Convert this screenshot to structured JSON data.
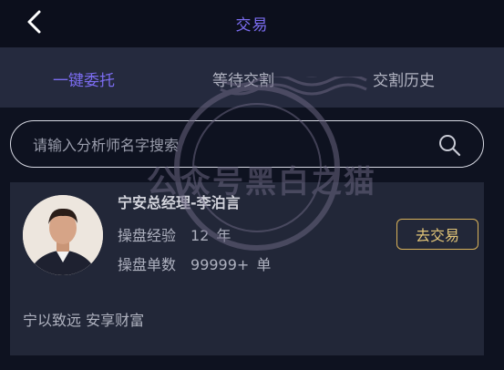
{
  "header": {
    "title": "交易"
  },
  "tabs": [
    {
      "label": "一键委托",
      "active": true
    },
    {
      "label": "等待交割",
      "active": false
    },
    {
      "label": "交割历史",
      "active": false
    }
  ],
  "search": {
    "placeholder": "请输入分析师名字搜索"
  },
  "analyst": {
    "name": "宁安总经理-李泊言",
    "experience_label": "操盘经验",
    "experience_value": "12",
    "experience_unit": "年",
    "orders_label": "操盘单数",
    "orders_value": "99999+",
    "orders_unit": "单",
    "motto": "宁以致远 安享财富",
    "trade_button": "去交易"
  },
  "watermark": {
    "text": "公众号黑白之猫"
  },
  "colors": {
    "accent": "#7b6cf0",
    "button_border": "#d9b25a",
    "background": "#0e1220",
    "card": "#222738"
  },
  "icons": {
    "back": "chevron-left-icon",
    "search": "search-icon"
  }
}
